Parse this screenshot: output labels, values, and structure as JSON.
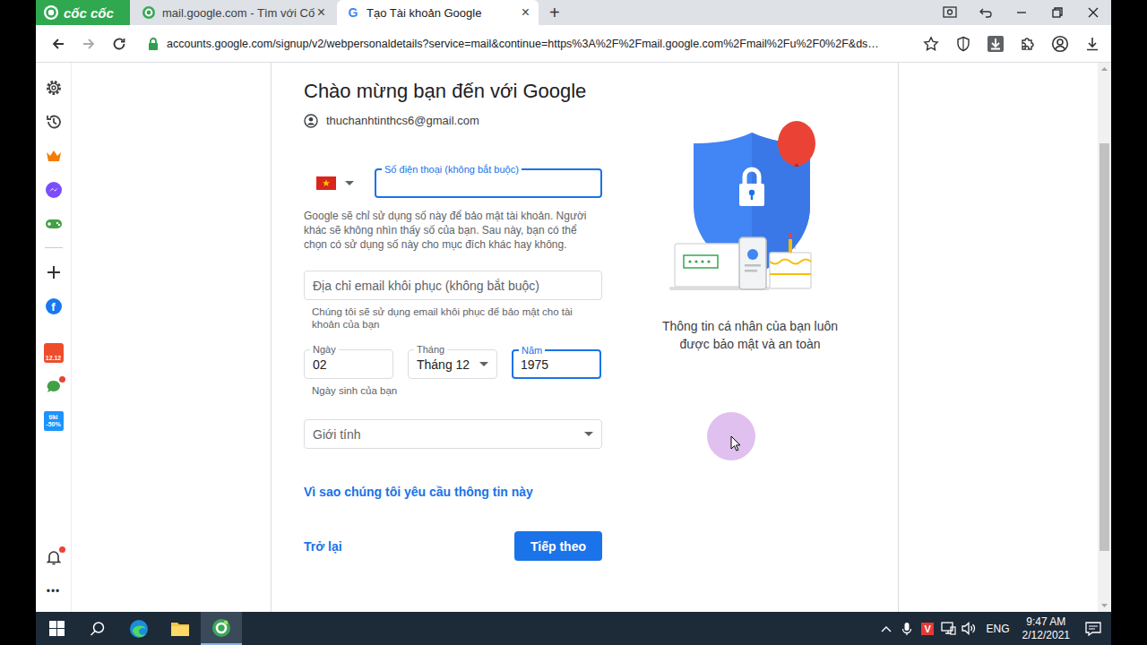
{
  "browser": {
    "brand": "cốc cốc",
    "tabs": [
      {
        "label": "mail.google.com - Tìm với Cố",
        "selected": false,
        "kind": "search",
        "favicon": ""
      },
      {
        "label": "Tạo Tài khoản Google",
        "selected": true,
        "kind": "google",
        "favicon": "G"
      }
    ],
    "close_glyph": "×",
    "new_tab": "+",
    "url": "accounts.google.com/signup/v2/webpersonaldetails?service=mail&continue=https%3A%2F%2Fmail.google.com%2Fmail%2Fu%2F0%2F&ds…"
  },
  "sidebar": {
    "top": [
      {
        "kind": "settings",
        "labels": [],
        "badge": false
      },
      {
        "kind": "history",
        "labels": [],
        "badge": false
      },
      {
        "kind": "crown",
        "labels": [],
        "badge": false
      },
      {
        "kind": "messenger",
        "labels": [],
        "badge": false
      },
      {
        "kind": "game",
        "labels": [],
        "badge": false
      },
      {
        "kind": "divider",
        "labels": [],
        "badge": false
      },
      {
        "kind": "plus",
        "labels": [],
        "badge": false
      },
      {
        "kind": "facebook",
        "labels": [
          "f"
        ],
        "badge": false
      },
      {
        "kind": "shopee",
        "labels": [
          "12.12"
        ],
        "badge": false
      },
      {
        "kind": "chat",
        "labels": [],
        "badge": true
      },
      {
        "kind": "tiki",
        "labels": [
          "tiki",
          "-50%"
        ],
        "badge": false
      }
    ],
    "bottom": [
      {
        "kind": "bell",
        "labels": [],
        "badge": true
      },
      {
        "kind": "more",
        "labels": [
          "•••"
        ],
        "badge": false
      }
    ]
  },
  "form": {
    "heading": "Chào mừng bạn đến với Google",
    "account": "thuchanhtinthcs6@gmail.com",
    "phone": {
      "label": "Số điện thoại (không bắt buộc)",
      "value": "",
      "focused": true,
      "help": "Google sẽ chỉ sử dụng số này để bảo mật tài khoản. Người khác sẽ không nhìn thấy số của bạn. Sau này, bạn có thể chọn có sử dụng số này cho mục đích khác hay không."
    },
    "recovery": {
      "placeholder": "Địa chỉ email khôi phục (không bắt buộc)",
      "value": "",
      "focused": false,
      "help": "Chúng tôi sẽ sử dụng email khôi phục để bảo mật cho tài khoản của bạn"
    },
    "birthday": {
      "fields": [
        {
          "label": "Ngày",
          "value": "02",
          "kind": "input",
          "focused": false
        },
        {
          "label": "Tháng",
          "value": "Tháng 12",
          "kind": "select",
          "focused": false
        },
        {
          "label": "Năm",
          "value": "1975",
          "kind": "input",
          "focused": true
        }
      ],
      "help": "Ngày sinh của bạn"
    },
    "gender": {
      "placeholder": "Giới tính",
      "value": ""
    },
    "why_link": "Vì sao chúng tôi yêu cầu thông tin này",
    "back": "Trở lại",
    "next": "Tiếp theo"
  },
  "illustration_caption": "Thông tin cá nhân của bạn luôn được bảo mật và an toàn",
  "taskbar": {
    "apps": [
      {
        "kind": "windows",
        "selected": false
      },
      {
        "kind": "search",
        "selected": false
      },
      {
        "kind": "edge",
        "selected": false
      },
      {
        "kind": "explorer",
        "selected": false
      },
      {
        "kind": "coccoc",
        "selected": true
      }
    ],
    "ime": "V",
    "language": "ENG",
    "time": "9:47 AM",
    "date": "2/12/2021"
  }
}
